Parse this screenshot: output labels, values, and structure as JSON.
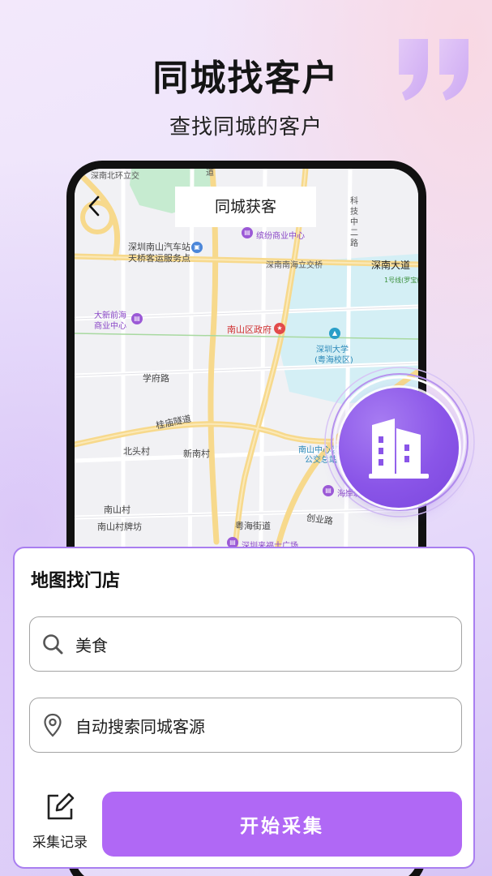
{
  "header": {
    "title": "同城找客户",
    "subtitle": "查找同城的客户"
  },
  "phone_screen": {
    "title": "同城获客",
    "map_labels": {
      "north_ring": "深南北环立交",
      "road_top": "道",
      "keji_road": "科技中二路",
      "bus_station_1": "深圳南山汽车站",
      "bus_station_2": "天桥客运服务点",
      "coco_park": "缤纷商业中心",
      "shennan_interchange": "深南南海立交桥",
      "shennan_avenue": "深南大道",
      "metro_line": "1号线(罗宝线",
      "qianhai_1": "大新前海",
      "qianhai_2": "商业中心",
      "district_gov": "南山区政府",
      "szu_1": "深圳大学",
      "szu_2": "(粤海校区)",
      "xuefu_road": "学府路",
      "guimiao_tunnel": "桂庙隧道",
      "beitou_village": "北头村",
      "xinnan_village": "新南村",
      "nanshan_center_1": "南山中心区",
      "nanshan_center_2": "公交总站",
      "haian": "海岸城",
      "nanshan_village": "南山村",
      "nanshan_arch": "南山村牌坊",
      "yuehai_street": "粤海街道",
      "chuangye_road": "创业路",
      "laifushi": "深圳来福士广场"
    }
  },
  "card": {
    "title": "地图找门店",
    "keyword_value": "美食",
    "location_value": "自动搜索同城客源",
    "record_label": "采集记录",
    "start_label": "开始采集"
  },
  "colors": {
    "accent": "#b068f5",
    "card_border": "#a97ef0",
    "badge_purple": "#8a55e8",
    "poi_red": "#e24a4a",
    "poi_purple": "#9b59d6"
  },
  "icons": {
    "back": "chevron-left-icon",
    "building": "building-icon",
    "search": "search-icon",
    "location": "location-pin-icon",
    "record": "edit-note-icon",
    "quote": "quote-mark-icon"
  }
}
